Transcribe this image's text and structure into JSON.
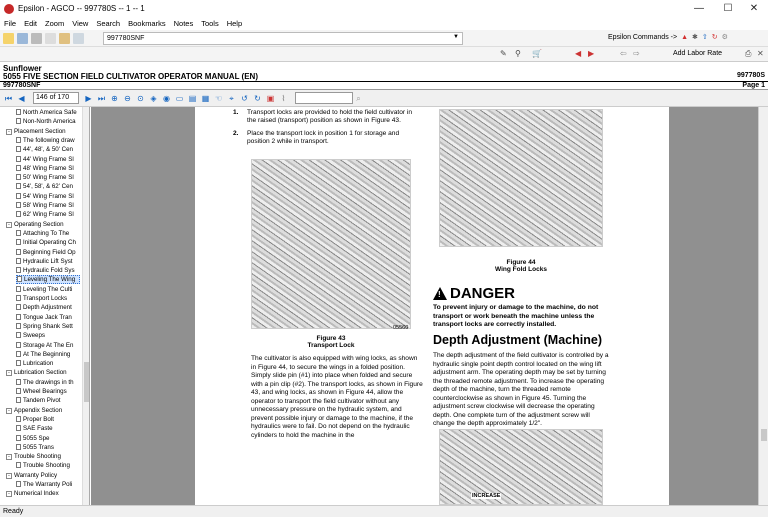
{
  "window": {
    "title": "Epsilon - AGCO -- 997780S -- 1 -- 1",
    "minimize": "—",
    "maximize": "☐",
    "close": "✕"
  },
  "menu": [
    "File",
    "Edit",
    "Zoom",
    "View",
    "Search",
    "Bookmarks",
    "Notes",
    "Tools",
    "Help"
  ],
  "toolbar": {
    "document": "997780SNF",
    "epsilon_commands": "Epsilon Commands ->",
    "add_labor": "Add Labor Rate"
  },
  "header": {
    "brand": "Sunflower",
    "title": "5055 FIVE SECTION FIELD CULTIVATOR OPERATOR MANUAL (EN)",
    "doc_number": "997780S",
    "doc_code": "997780SNF",
    "page_label": "Page 1"
  },
  "nav": {
    "page_value": "146 of 170"
  },
  "tree": [
    {
      "label": "North America Safe",
      "level": 2,
      "type": "doc"
    },
    {
      "label": "Non-North America",
      "level": 2,
      "type": "doc"
    },
    {
      "label": "Placement Section",
      "level": 1,
      "type": "folder"
    },
    {
      "label": "The following draw",
      "level": 2,
      "type": "doc"
    },
    {
      "label": "44', 48', & 50' Cen",
      "level": 2,
      "type": "doc"
    },
    {
      "label": "44' Wing Frame Sl",
      "level": 2,
      "type": "doc"
    },
    {
      "label": "48' Wing Frame Sl",
      "level": 2,
      "type": "doc"
    },
    {
      "label": "50' Wing Frame Sl",
      "level": 2,
      "type": "doc"
    },
    {
      "label": "54', 58', & 62' Cen",
      "level": 2,
      "type": "doc"
    },
    {
      "label": "54' Wing Frame Sl",
      "level": 2,
      "type": "doc"
    },
    {
      "label": "58' Wing Frame Sl",
      "level": 2,
      "type": "doc"
    },
    {
      "label": "62' Wing Frame Sl",
      "level": 2,
      "type": "doc"
    },
    {
      "label": "Operating Section",
      "level": 1,
      "type": "folder"
    },
    {
      "label": "Attaching To The",
      "level": 2,
      "type": "doc"
    },
    {
      "label": "Initial Operating Ch",
      "level": 2,
      "type": "doc"
    },
    {
      "label": "Beginning Field Op",
      "level": 2,
      "type": "doc"
    },
    {
      "label": "Hydraulic Lift Syst",
      "level": 2,
      "type": "doc"
    },
    {
      "label": "Hydraulic Fold Sys",
      "level": 2,
      "type": "doc"
    },
    {
      "label": "Leveling The Wing",
      "level": 2,
      "type": "doc",
      "selected": true
    },
    {
      "label": "Leveling The Culti",
      "level": 2,
      "type": "doc"
    },
    {
      "label": "Transport Locks",
      "level": 2,
      "type": "doc"
    },
    {
      "label": "Depth Adjustment",
      "level": 2,
      "type": "doc"
    },
    {
      "label": "Tongue Jack Tran",
      "level": 2,
      "type": "doc"
    },
    {
      "label": "Spring Shank Sett",
      "level": 2,
      "type": "doc"
    },
    {
      "label": "Sweeps",
      "level": 2,
      "type": "doc"
    },
    {
      "label": "Storage At The En",
      "level": 2,
      "type": "doc"
    },
    {
      "label": "At The Beginning",
      "level": 2,
      "type": "doc"
    },
    {
      "label": "Lubrication",
      "level": 2,
      "type": "doc"
    },
    {
      "label": "Lubrication Section",
      "level": 1,
      "type": "folder"
    },
    {
      "label": "The drawings in th",
      "level": 2,
      "type": "doc"
    },
    {
      "label": "Wheel Bearings",
      "level": 2,
      "type": "doc"
    },
    {
      "label": "Tandem Pivot",
      "level": 2,
      "type": "doc"
    },
    {
      "label": "Appendix Section",
      "level": 1,
      "type": "folder"
    },
    {
      "label": "Proper Bolt",
      "level": 2,
      "type": "doc"
    },
    {
      "label": "SAE Faste",
      "level": 2,
      "type": "doc"
    },
    {
      "label": "5055 Spe",
      "level": 2,
      "type": "doc"
    },
    {
      "label": "5055 Trans",
      "level": 2,
      "type": "doc"
    },
    {
      "label": "Trouble Shooting",
      "level": 1,
      "type": "folder"
    },
    {
      "label": "Trouble Shooting",
      "level": 2,
      "type": "doc"
    },
    {
      "label": "Warranty Policy",
      "level": 1,
      "type": "folder"
    },
    {
      "label": "The Warranty Poli",
      "level": 2,
      "type": "doc"
    },
    {
      "label": "Numerical Index",
      "level": 1,
      "type": "folder"
    }
  ],
  "page": {
    "step1": "Transport locks are provided to hold the field cultivator in the raised (transport) position as shown in Figure 43.",
    "step2": "Place the transport lock in position 1 for storage and position 2 while in transport.",
    "fig43_id": "05560",
    "fig43_caption_a": "Figure 43",
    "fig43_caption_b": "Transport Lock",
    "left_para": "The cultivator is also equipped with wing locks, as shown in Figure 44, to secure the wings in a folded position. Simply slide pin (#1) into place when folded and secure with a pin clip (#2). The transport locks, as shown in Figure 43, and wing locks, as shown in Figure 44, allow the operator to transport the field cultivator without any unnecessary pressure on the hydraulic system, and prevent possible injury or damage to the machine, if the hydraulics were to fail. Do not depend on the hydraulic cylinders to hold the machine in the",
    "fig44_caption_a": "Figure 44",
    "fig44_caption_b": "Wing Fold Locks",
    "danger_word": "DANGER",
    "danger_text": "To prevent injury or damage to the machine, do not transport or work beneath the machine unless the transport locks are correctly installed.",
    "section_title": "Depth Adjustment (Machine)",
    "right_para": "The depth adjustment of the field cultivator is controlled by a hydraulic single point depth control located on the wing lift adjustment arm. The operating depth may be set by turning the threaded remote adjustment. To increase the operating depth of the machine, turn the threaded remote counterclockwise as shown in Figure 45. Turning the adjustment screw clockwise will decrease the operating depth. One complete turn of the adjustment screw will change the depth approximately 1/2\".",
    "fig45_label": "INCREASE"
  },
  "status": "Ready"
}
